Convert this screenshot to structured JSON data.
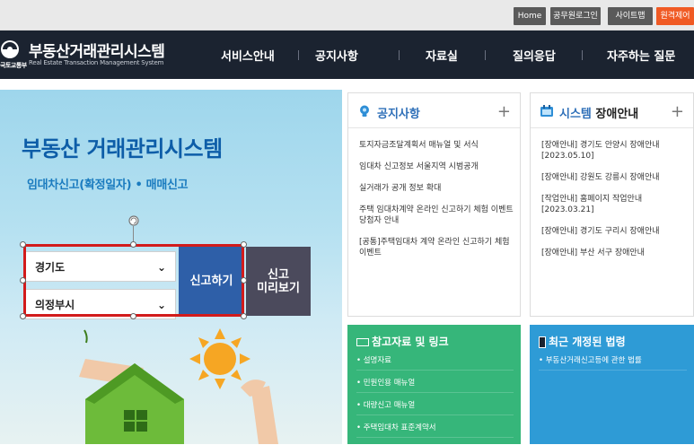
{
  "utility": {
    "home": "Home",
    "official_login": "공무원로그인",
    "sitemap": "사이트맵",
    "accessibility": "원격제어"
  },
  "header": {
    "ministry": "국토교통부",
    "title": "부동산거래관리시스템",
    "subtitle": "Real Estate Transaction Management System",
    "nav": [
      "서비스안내",
      "공지사항",
      "자료실",
      "질의응답",
      "자주하는 질문"
    ]
  },
  "hero": {
    "title": "부동산 거래관리시스템",
    "subtitle": "임대차신고(확정일자) • 매매신고",
    "province": "경기도",
    "city": "의정부시",
    "report_button": "신고하기",
    "preview_button_line1": "신고",
    "preview_button_line2": "미리보기"
  },
  "notice": {
    "title": "공지사항",
    "items": [
      "토지자금조달계획서 매뉴얼 및 서식",
      "임대차 신고정보 서울지역 시범공개",
      "실거래가 공개 정보 확대",
      "주택 임대차계약 온라인 신고하기 체험 이벤트 당첨자 안내",
      "[공통]주택임대차 계약 온라인 신고하기 체험 이벤트"
    ]
  },
  "outage": {
    "title_prefix": "시스템",
    "title_suffix": "장애안내",
    "items": [
      "[장애안내] 경기도 안양시 장애안내 [2023.05.10]",
      "[장애안내] 강원도 강릉시 장애안내",
      "[작업안내] 홈페이지 작업안내 [2023.03.21]",
      "[장애안내] 경기도 구리시 장애안내",
      "[장애안내] 부산 서구 장애안내"
    ]
  },
  "refs": {
    "title": "참고자료 및 링크",
    "items": [
      "설명자료",
      "민원인용 매뉴얼",
      "대량신고 매뉴얼",
      "주택임대차 표준계약서"
    ]
  },
  "laws": {
    "title": "최근 개정된 법령",
    "items": [
      "부동산거래신고등에 관한 법률"
    ]
  },
  "colors": {
    "header_bg": "#1b2330",
    "accent_orange": "#f05a24",
    "hero_title": "#0d5da8",
    "report_button": "#2e5fa8",
    "preview_button": "#4b4a5c",
    "selection_frame": "#d21b1b",
    "refs_panel": "#36b67a",
    "laws_panel": "#2e9bd6"
  },
  "icons": {
    "notice": "lightbulb-icon",
    "outage": "calendar-icon",
    "refs": "card-icon",
    "laws": "phone-icon"
  }
}
